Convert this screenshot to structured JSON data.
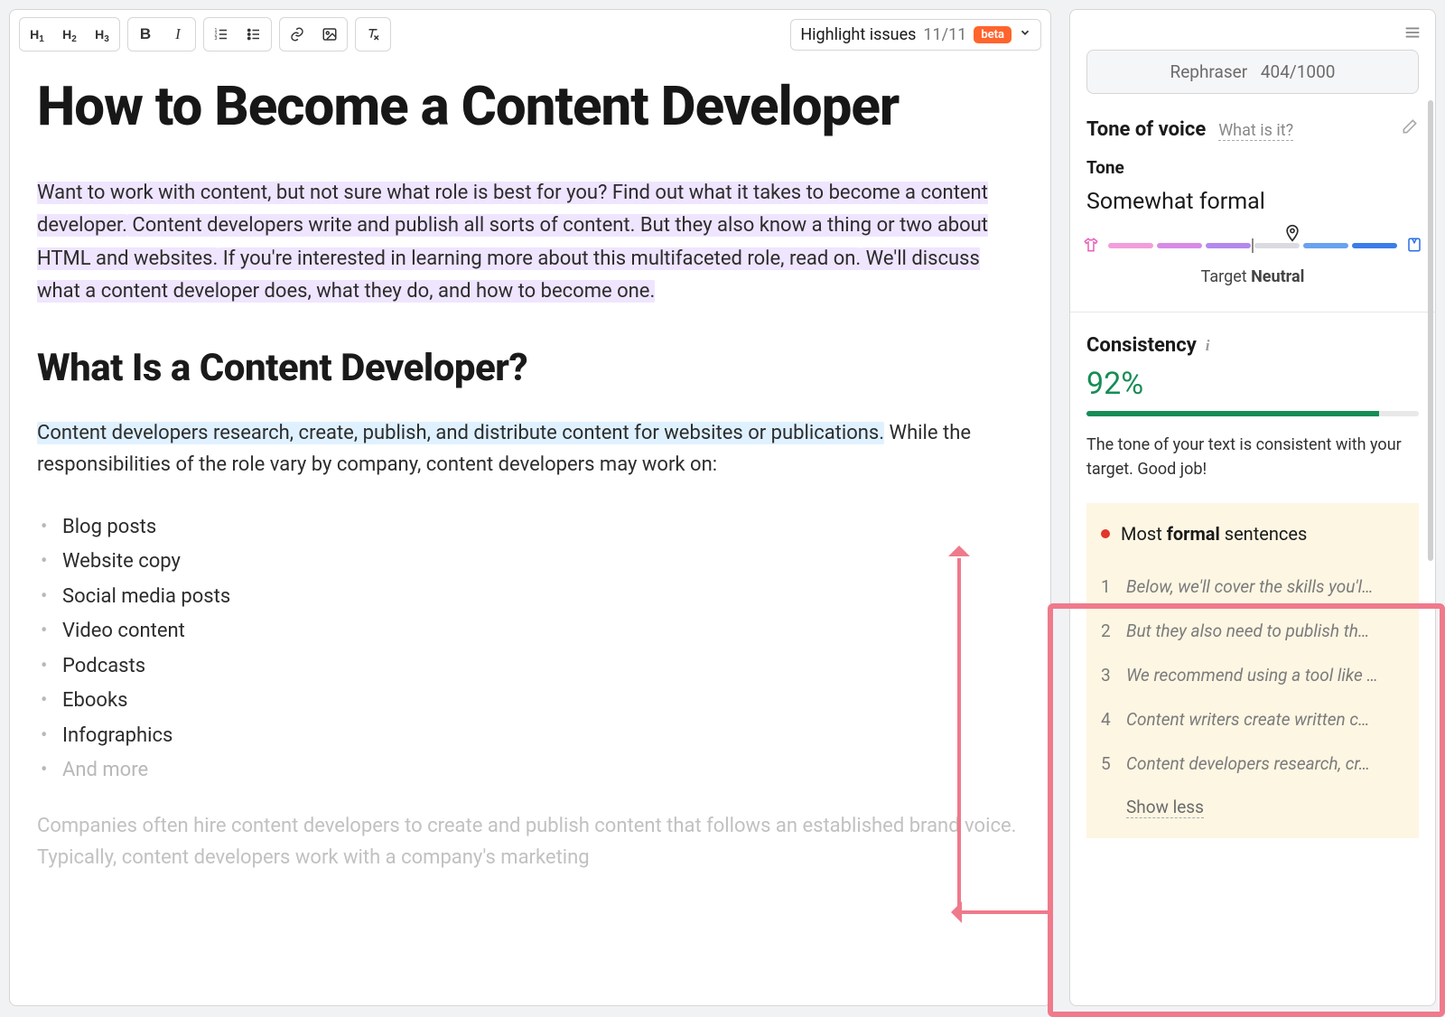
{
  "toolbar": {
    "highlight_label": "Highlight issues",
    "highlight_count": "11/11",
    "beta": "beta"
  },
  "doc": {
    "title": "How to Become a Content Developer",
    "intro_1": "Want to work with content, but not sure what role is best for you? Find out what it takes to become a content developer.",
    "intro_2": " Content developers write and publish all sorts of content. But they also know a thing or two about HTML and websites.",
    "intro_3": " If you're interested in learning more about this multifaceted role, read on.",
    "intro_4": " We'll discuss what a content developer does, what they do, and how to become one.",
    "h2": "What Is a Content Developer?",
    "p2_hl": "Content developers research, create, publish, and distribute content for websites or publications.",
    "p2_rest": " While the responsibilities of the role vary by company, content developers may work on:",
    "list": [
      "Blog posts",
      "Website copy",
      "Social media posts",
      "Video content",
      "Podcasts",
      "Ebooks",
      "Infographics"
    ],
    "list_muted": "And more",
    "faded": "Companies often hire content developers to create and publish content that follows an established brand voice. Typically, content developers work with a company's marketing"
  },
  "sidebar": {
    "rephraser_label": "Rephraser",
    "rephraser_count": "404/1000",
    "tone_title": "Tone of voice",
    "what_is_it": "What is it?",
    "tone_label": "Tone",
    "tone_value": "Somewhat formal",
    "target_prefix": "Target ",
    "target_value": "Neutral",
    "consistency_title": "Consistency",
    "consistency_pct": "92%",
    "consistency_fill": 88,
    "consistency_msg": "The tone of your text is consistent with your target. Good job!",
    "formal_prefix": "Most ",
    "formal_bold": "formal",
    "formal_suffix": " sentences",
    "sentences": [
      "Below, we'll cover the skills you'l…",
      "But they also need to publish th…",
      "We recommend using a tool like …",
      "Content writers create written c…",
      "Content developers research, cr…"
    ],
    "show_less": "Show less"
  }
}
